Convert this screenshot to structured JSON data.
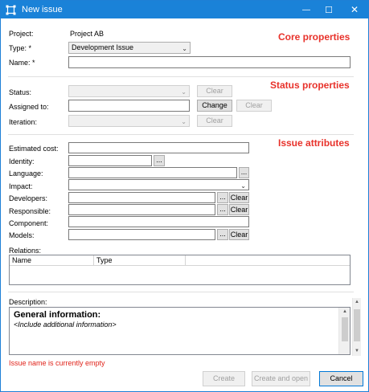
{
  "window": {
    "title": "New issue",
    "minimize_glyph": "—",
    "maximize_glyph": "☐",
    "close_glyph": "✕"
  },
  "sections": {
    "core": "Core properties",
    "status": "Status properties",
    "attributes": "Issue attributes"
  },
  "core": {
    "project_label": "Project:",
    "project_value": "Project AB",
    "type_label": "Type: *",
    "type_value": "Development Issue",
    "name_label": "Name: *",
    "name_value": ""
  },
  "status": {
    "status_label": "Status:",
    "status_value": "",
    "status_clear": "Clear",
    "assigned_label": "Assigned to:",
    "assigned_value": "",
    "assigned_change": "Change",
    "assigned_clear": "Clear",
    "iteration_label": "Iteration:",
    "iteration_value": "",
    "iteration_clear": "Clear"
  },
  "attributes": {
    "estimated_cost_label": "Estimated cost:",
    "identity_label": "Identity:",
    "language_label": "Language:",
    "impact_label": "Impact:",
    "developers_label": "Developers:",
    "responsible_label": "Responsible:",
    "component_label": "Component:",
    "models_label": "Models:",
    "browse": "...",
    "clear": "Clear"
  },
  "relations": {
    "label": "Relations:",
    "columns": [
      "Name",
      "Type"
    ]
  },
  "description": {
    "label": "Description:",
    "heading": "General information:",
    "placeholder": "<Include additional information>"
  },
  "validation_message": "Issue name is currently empty",
  "buttons": {
    "create": "Create",
    "create_and_open": "Create and open",
    "cancel": "Cancel"
  },
  "icons": {
    "app": "issue-icon",
    "dropdown": "chevron-down-icon"
  }
}
